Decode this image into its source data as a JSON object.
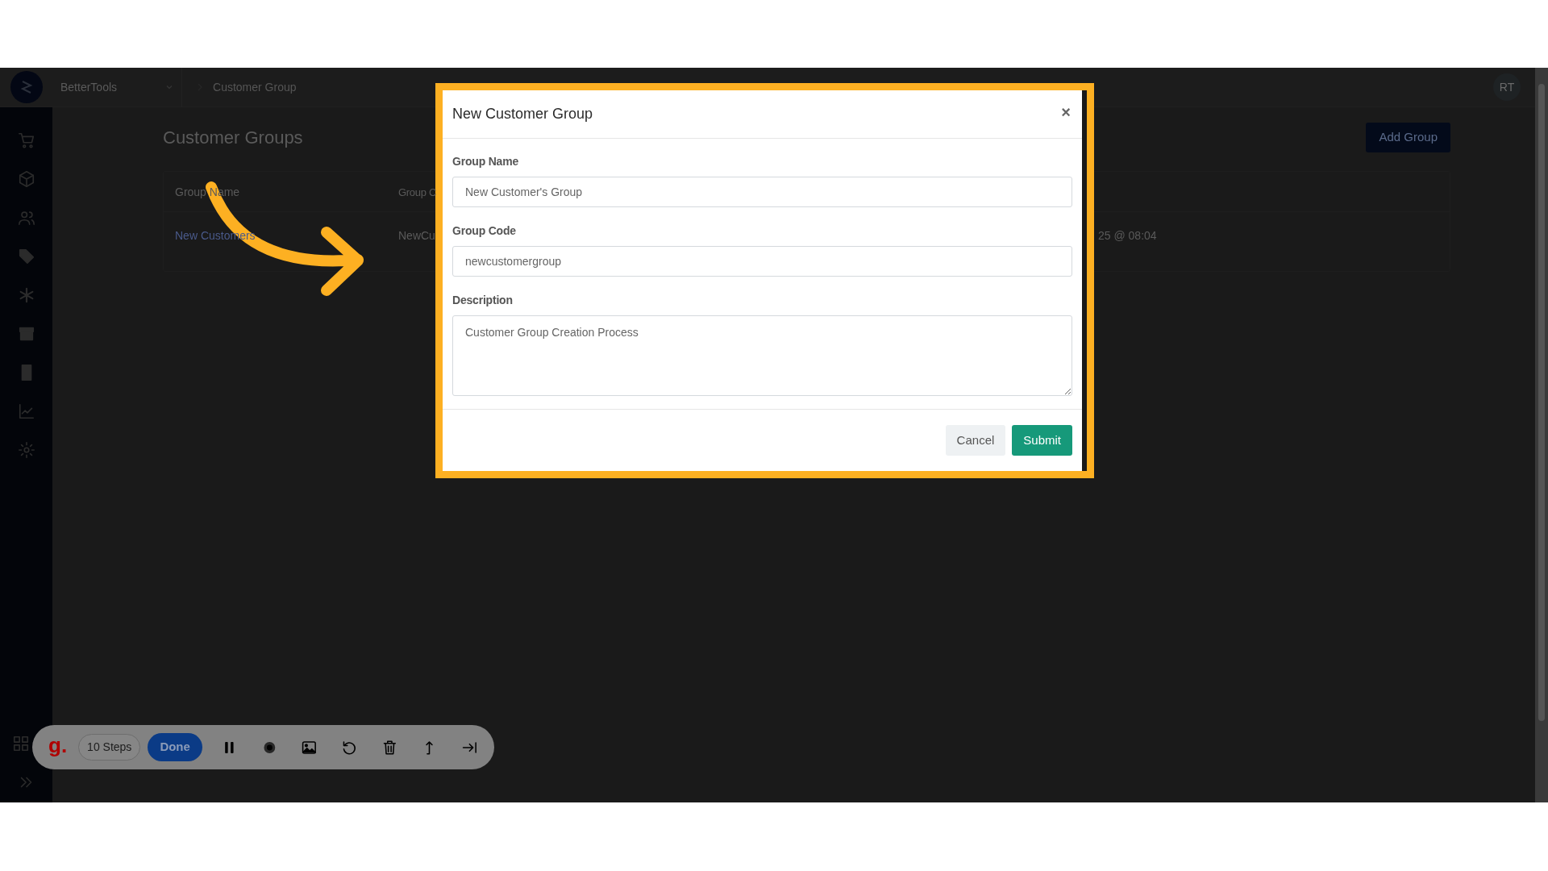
{
  "topbar": {
    "org_selector": "BetterTools",
    "breadcrumb": "Customer Group",
    "avatar": "RT"
  },
  "page": {
    "title": "Customer Groups",
    "add_button": "Add Group",
    "table": {
      "columns": [
        "Group Name",
        "Group C"
      ],
      "rows": [
        {
          "cells": [
            "New Customers",
            "NewCu",
            "25 @ 08:04"
          ]
        }
      ]
    }
  },
  "modal": {
    "title": "New Customer Group",
    "close": "×",
    "fields": [
      {
        "label": "Group Name",
        "kind": "input",
        "value": "New Customer's Group"
      },
      {
        "label": "Group Code",
        "kind": "input",
        "value": "newcustomergroup"
      },
      {
        "label": "Description",
        "kind": "textarea",
        "value": "Customer Group Creation Process"
      }
    ],
    "buttons": [
      {
        "label": "Cancel",
        "kind": "secondary"
      },
      {
        "label": "Submit",
        "kind": "primary"
      }
    ]
  },
  "recorder": {
    "logo": "g.",
    "steps": "10 Steps",
    "done": "Done"
  }
}
